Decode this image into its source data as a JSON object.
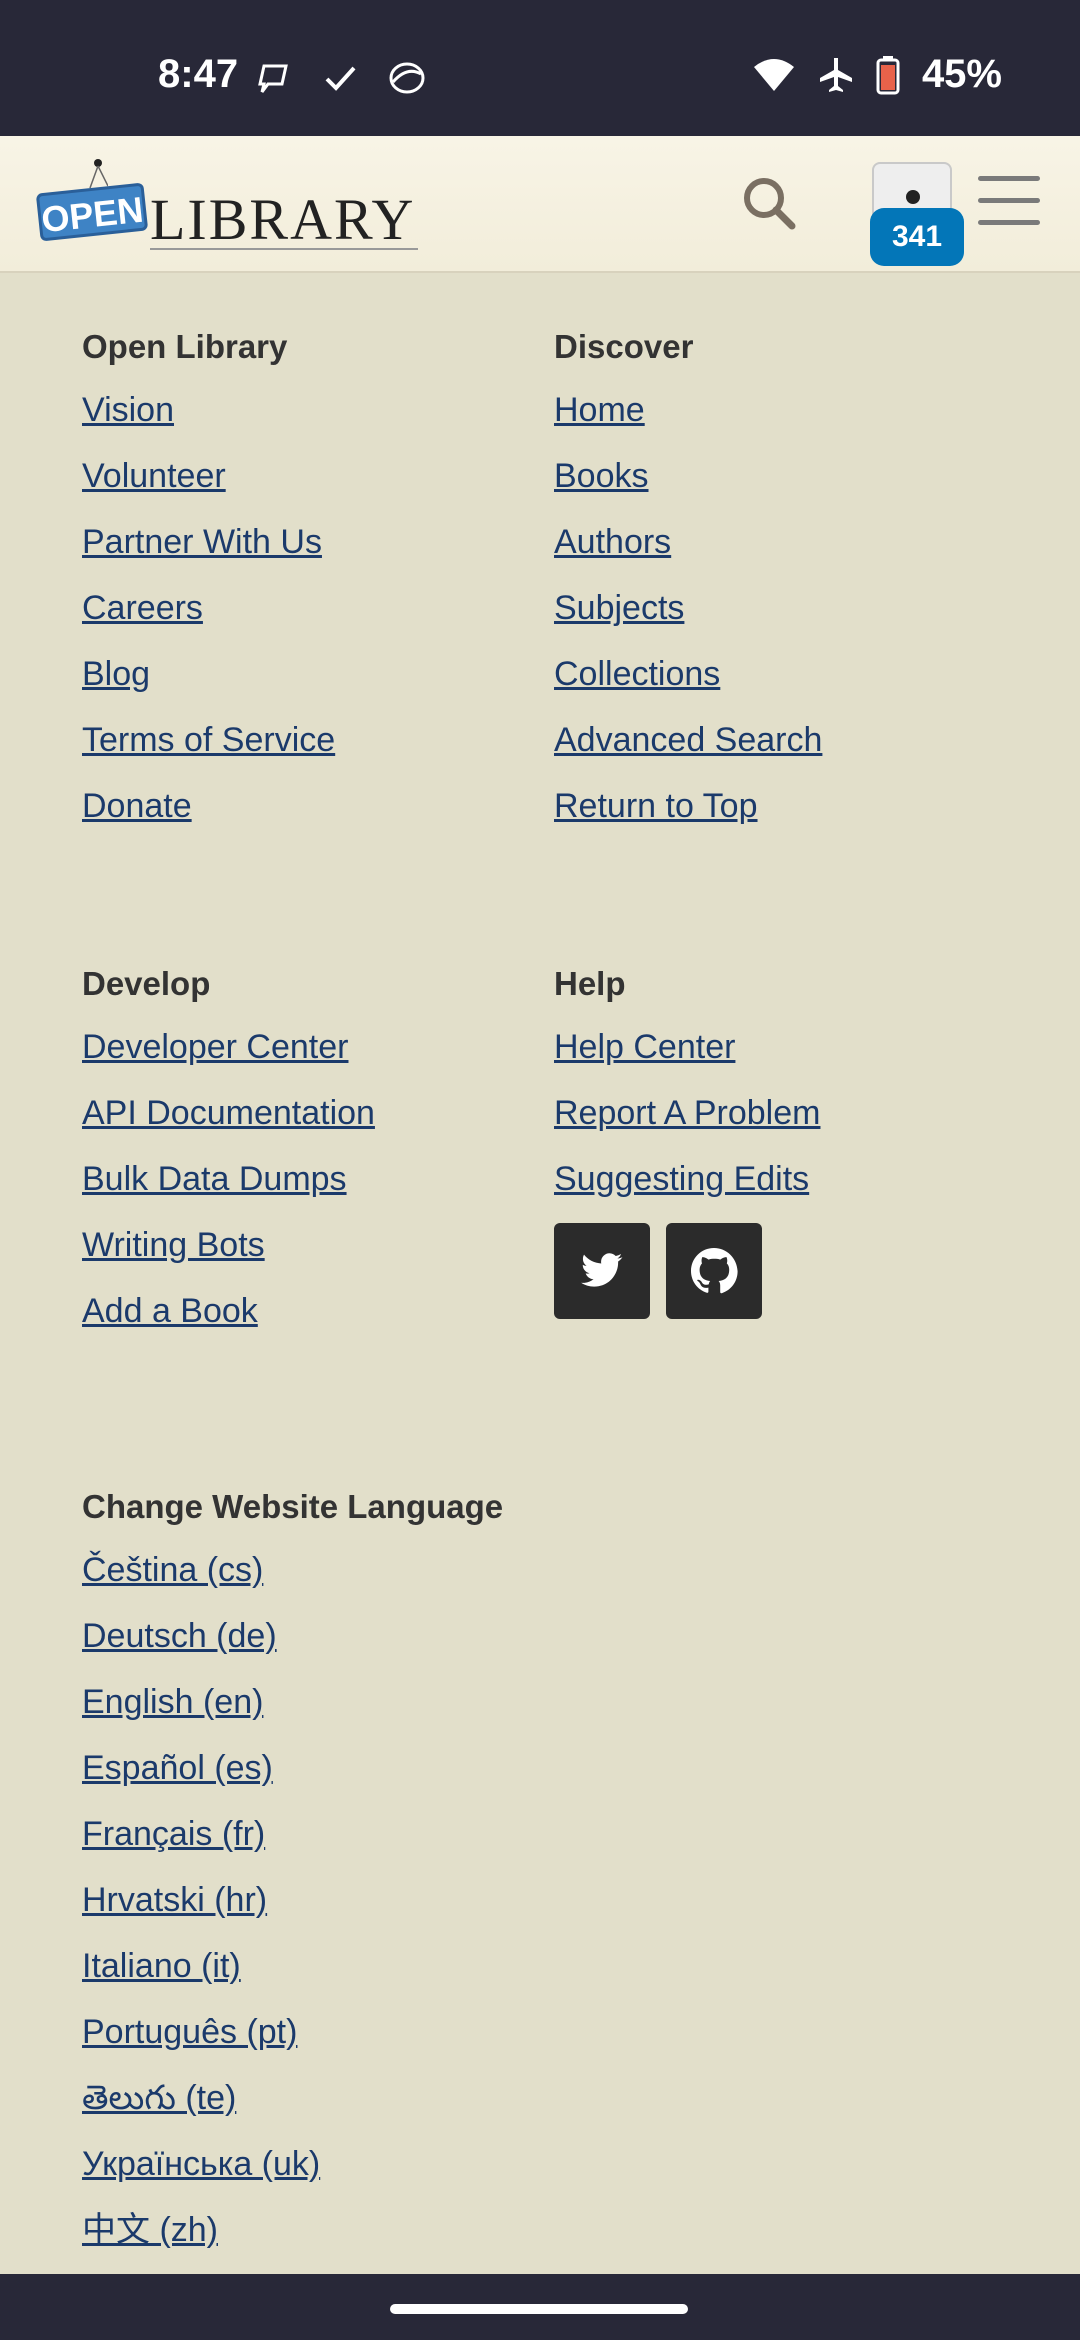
{
  "status_bar": {
    "time": "8:47",
    "battery": "45%",
    "icons": [
      "chat-icon",
      "check-icon",
      "ring-icon",
      "wifi-icon",
      "airplane-icon",
      "battery-icon"
    ]
  },
  "header": {
    "logo_open": "OPEN",
    "logo_library": "LIBRARY",
    "badge_count": "341"
  },
  "footer": {
    "open_library": {
      "title": "Open Library",
      "links": [
        "Vision",
        "Volunteer",
        "Partner With Us",
        "Careers",
        "Blog",
        "Terms of Service",
        "Donate"
      ]
    },
    "discover": {
      "title": "Discover",
      "links": [
        "Home",
        "Books",
        "Authors",
        "Subjects",
        "Collections",
        "Advanced Search",
        "Return to Top"
      ]
    },
    "develop": {
      "title": "Develop",
      "links": [
        "Developer Center",
        "API Documentation",
        "Bulk Data Dumps",
        "Writing Bots",
        "Add a Book"
      ]
    },
    "help": {
      "title": "Help",
      "links": [
        "Help Center",
        "Report A Problem",
        "Suggesting Edits"
      ],
      "social": [
        "twitter-icon",
        "github-icon"
      ]
    },
    "language": {
      "title": "Change Website Language",
      "links": [
        "Čeština (cs)",
        "Deutsch (de)",
        "English (en)",
        "Español (es)",
        "Français (fr)",
        "Hrvatski (hr)",
        "Italiano (it)",
        "Português (pt)",
        "తెలుగు (te)",
        "Українська (uk)",
        "中文 (zh)"
      ]
    }
  },
  "colors": {
    "background": "#e2dfca",
    "link": "#1b3a6b",
    "badge": "#0376b8",
    "system_bar": "#282838"
  }
}
